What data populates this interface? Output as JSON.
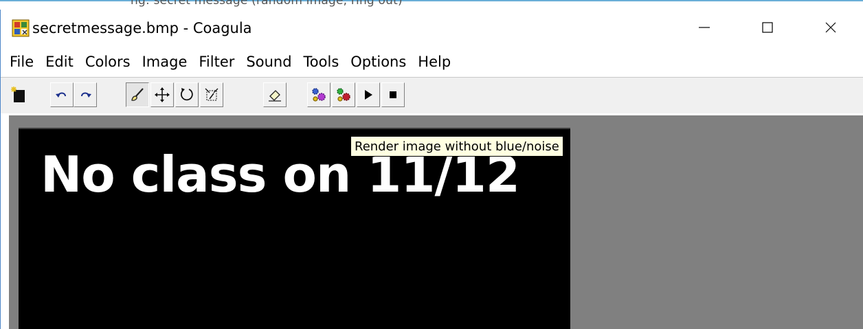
{
  "top_strip": {
    "text": "ng: secret message (random image, ring out)"
  },
  "window": {
    "title": "secretmessage.bmp - Coagula"
  },
  "menu": [
    {
      "label": "File"
    },
    {
      "label": "Edit"
    },
    {
      "label": "Colors"
    },
    {
      "label": "Image"
    },
    {
      "label": "Filter"
    },
    {
      "label": "Sound"
    },
    {
      "label": "Tools"
    },
    {
      "label": "Options"
    },
    {
      "label": "Help"
    }
  ],
  "toolbar": {
    "buttons": [
      {
        "icon": "new-image-icon"
      },
      {
        "icon": "undo-icon"
      },
      {
        "icon": "redo-icon"
      },
      {
        "icon": "brush-icon",
        "pressed": true
      },
      {
        "icon": "move-icon"
      },
      {
        "icon": "rotate-icon"
      },
      {
        "icon": "transform-icon"
      },
      {
        "icon": "eraser-icon"
      },
      {
        "icon": "render-icon"
      },
      {
        "icon": "render-noise-icon"
      },
      {
        "icon": "play-icon"
      },
      {
        "icon": "stop-icon"
      }
    ]
  },
  "canvas": {
    "text": "No class on 11/12",
    "background": "#000000",
    "text_color": "#ffffff"
  },
  "workspace": {
    "background": "#808080"
  },
  "tooltip": {
    "text": "Render image without blue/noise"
  }
}
